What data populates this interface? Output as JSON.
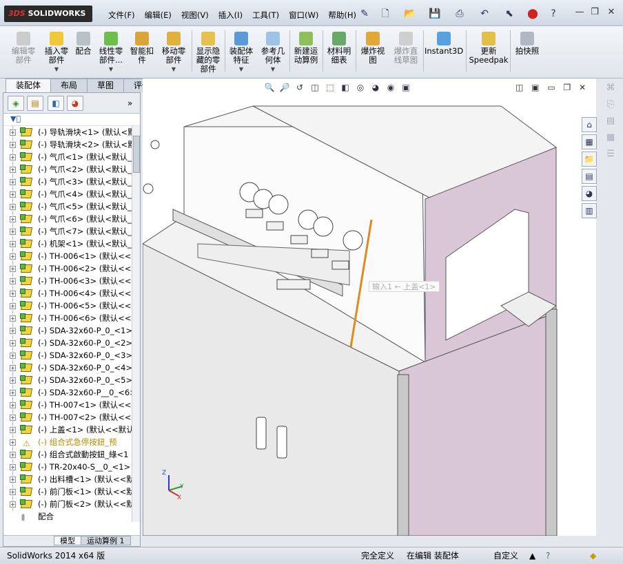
{
  "app": {
    "logo_prefix": "3DS",
    "logo_text": "SOLIDWORKS"
  },
  "menu": [
    "文件(F)",
    "编辑(E)",
    "视图(V)",
    "插入(I)",
    "工具(T)",
    "窗口(W)",
    "帮助(H)"
  ],
  "toolbar": [
    {
      "label": "编辑零\n部件",
      "disabled": true
    },
    {
      "label": "插入零\n部件",
      "dropdown": true
    },
    {
      "label": "配合"
    },
    {
      "label": "线性零\n部件...",
      "dropdown": true
    },
    {
      "label": "智能扣\n件"
    },
    {
      "label": "移动零\n部件",
      "dropdown": true
    },
    {
      "label": "显示隐\n藏的零\n部件"
    },
    {
      "label": "装配体\n特征",
      "dropdown": true
    },
    {
      "label": "参考几\n何体",
      "dropdown": true
    },
    {
      "label": "新建运\n动算例"
    },
    {
      "label": "材料明\n细表"
    },
    {
      "label": "爆炸视\n图"
    },
    {
      "label": "爆炸直\n线草图",
      "disabled": true
    },
    {
      "label": "Instant3D"
    },
    {
      "label": "更新\nSpeedpak"
    },
    {
      "label": "拍快照"
    }
  ],
  "command_tabs": [
    "装配体",
    "布局",
    "草图",
    "评估"
  ],
  "tree": [
    {
      "label": "(-) 导轨滑块<1> (默认<默",
      "expand": "+"
    },
    {
      "label": "(-) 导轨滑块<2> (默认<默",
      "expand": "+"
    },
    {
      "label": "(-) 气爪<1> (默认<默认_",
      "expand": "+"
    },
    {
      "label": "(-) 气爪<2> (默认<默认_",
      "expand": "+"
    },
    {
      "label": "(-) 气爪<3> (默认<默认_",
      "expand": "+"
    },
    {
      "label": "(-) 气爪<4> (默认<默认_",
      "expand": "+"
    },
    {
      "label": "(-) 气爪<5> (默认<默认_",
      "expand": "+"
    },
    {
      "label": "(-) 气爪<6> (默认<默认_",
      "expand": "+"
    },
    {
      "label": "(-) 气爪<7> (默认<默认_",
      "expand": "+"
    },
    {
      "label": "(-) 机架<1> (默认<默认_",
      "expand": "+"
    },
    {
      "label": "(-) TH-006<1> (默认<<默",
      "expand": "+"
    },
    {
      "label": "(-) TH-006<2> (默认<<默",
      "expand": "+"
    },
    {
      "label": "(-) TH-006<3> (默认<<默",
      "expand": "+"
    },
    {
      "label": "(-) TH-006<4> (默认<<默",
      "expand": "+"
    },
    {
      "label": "(-) TH-006<5> (默认<<默",
      "expand": "+"
    },
    {
      "label": "(-) TH-006<6> (默认<<默",
      "expand": "+"
    },
    {
      "label": "(-) SDA-32x60-P_0_<1>",
      "expand": "+"
    },
    {
      "label": "(-) SDA-32x60-P_0_<2>",
      "expand": "+"
    },
    {
      "label": "(-) SDA-32x60-P_0_<3>",
      "expand": "+"
    },
    {
      "label": "(-) SDA-32x60-P_0_<4>",
      "expand": "+"
    },
    {
      "label": "(-) SDA-32x60-P_0_<5>",
      "expand": "+"
    },
    {
      "label": "(-) SDA-32x60-P__0_<6>",
      "expand": "+"
    },
    {
      "label": "(-) TH-007<1> (默认<<默",
      "expand": "+"
    },
    {
      "label": "(-) TH-007<2> (默认<<默",
      "expand": "+"
    },
    {
      "label": "(-) 上盖<1> (默认<<默认",
      "expand": "+"
    },
    {
      "label": "(-) 组合式急停按鈕_预",
      "expand": "+",
      "warning": true
    },
    {
      "label": "(-) 组合式啟動按鈕_綠<1",
      "expand": "+"
    },
    {
      "label": "(-) TR-20x40-S__0_<1> (",
      "expand": "+"
    },
    {
      "label": "(-) 出料槽<1> (默认<<默",
      "expand": "+"
    },
    {
      "label": "(-) 前门板<1> (默认<<默",
      "expand": "+"
    },
    {
      "label": "(-) 前门板<2> (默认<<默",
      "expand": "+"
    },
    {
      "label": "配合",
      "expand": "",
      "mates": true
    }
  ],
  "viewport": {
    "tooltip": "输入1 ← 上盖<1>",
    "axis_labels": {
      "x": "X",
      "y": "Y",
      "z": "Z"
    }
  },
  "bottom_tabs": [
    "模型",
    "运动算例 1"
  ],
  "status": {
    "left": "SolidWorks 2014 x64 版",
    "defined": "完全定义",
    "editing": "在编辑 装配体",
    "custom": "自定义"
  },
  "colors": {
    "accent": "#e08a1e",
    "body_panel": "#d9c7d8"
  }
}
